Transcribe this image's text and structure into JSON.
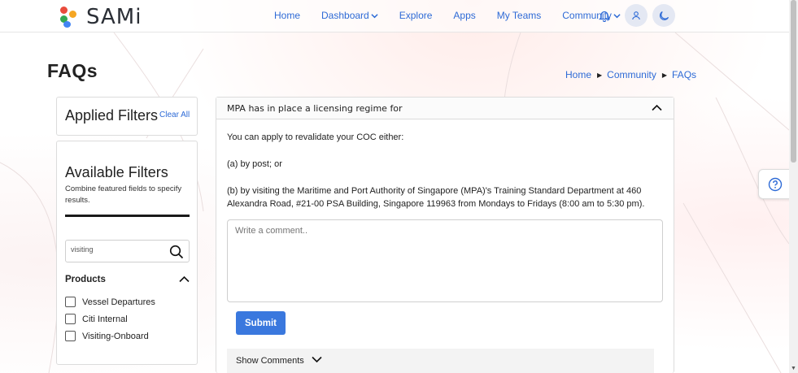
{
  "app": {
    "name": "SAMi"
  },
  "nav": {
    "items": [
      {
        "label": "Home",
        "dropdown": false
      },
      {
        "label": "Dashboard",
        "dropdown": true
      },
      {
        "label": "Explore",
        "dropdown": false
      },
      {
        "label": "Apps",
        "dropdown": false
      },
      {
        "label": "My Teams",
        "dropdown": false
      },
      {
        "label": "Community",
        "dropdown": true
      }
    ],
    "icons": [
      "bell-icon",
      "user-icon",
      "moon-icon"
    ]
  },
  "page": {
    "title": "FAQs",
    "breadcrumb": [
      "Home",
      "Community",
      "FAQs"
    ]
  },
  "filters": {
    "applied_title": "Applied Filters",
    "clear_all": "Clear All",
    "available_title": "Available Filters",
    "available_sub": "Combine featured fields to specify results.",
    "search_value": "visiting",
    "products_title": "Products",
    "products": [
      {
        "label": "Vessel Departures",
        "checked": false
      },
      {
        "label": "Citi Internal",
        "checked": false
      },
      {
        "label": "Visiting-Onboard",
        "checked": false
      }
    ]
  },
  "faq": {
    "question": "MPA has in place a licensing regime for",
    "answer": [
      "You can apply to revalidate your COC either:",
      "(a) by post; or",
      "(b) by visiting the Maritime and Port Authority of Singapore (MPA)'s Training Standard Department at 460 Alexandra Road, #21-00 PSA Building, Singapore 119963 from Mondays to Fridays (8:00 am to 5:30 pm)."
    ],
    "comment_placeholder": "Write a comment..",
    "submit_label": "Submit",
    "show_comments_label": "Show Comments"
  },
  "colors": {
    "accent": "#2d6ad6",
    "button": "#3a78de",
    "logo": [
      "#e94b3c",
      "#f5a623",
      "#34a853",
      "#4285f4"
    ]
  }
}
